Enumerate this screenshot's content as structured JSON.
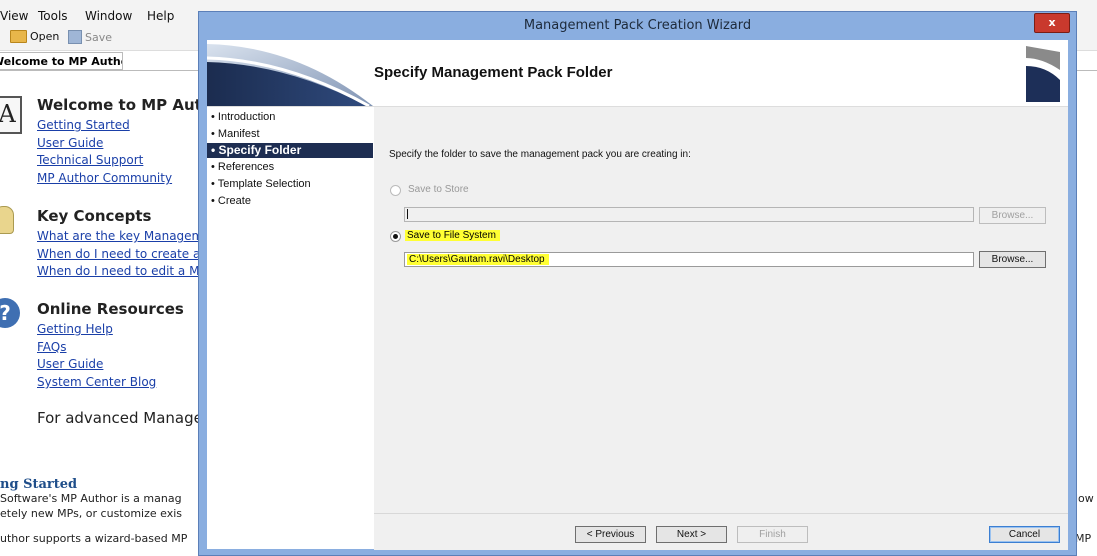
{
  "menu": [
    "View",
    "Tools",
    "Window",
    "Help"
  ],
  "toolbar": {
    "open_label": "Open",
    "save_label": "Save"
  },
  "doc_tab": {
    "label": "Welcome to MP Author!",
    "close": "×"
  },
  "welcome": {
    "heading": "Welcome to MP Author",
    "links": [
      "Getting Started",
      "User Guide",
      "Technical Support",
      "MP Author Community"
    ]
  },
  "key_concepts": {
    "heading": "Key Concepts",
    "links": [
      "What are the key Management",
      "When do I need to create a",
      "When do I need to edit a M"
    ]
  },
  "online": {
    "heading": "Online Resources",
    "links": [
      "Getting Help",
      "FAQs",
      "User Guide",
      "System Center Blog"
    ]
  },
  "advanced_text": "For advanced Manage",
  "getting_started": {
    "heading": "ng Started",
    "line1": "Software's MP Author is a manag",
    "line2": "etely new MPs, or customize exis",
    "line3": "uthor supports a wizard-based MP",
    "right1": "low",
    "right2": "MP"
  },
  "wizard": {
    "title": "Management Pack Creation Wizard",
    "close": "x",
    "heading": "Specify Management Pack Folder",
    "steps": [
      "Introduction",
      "Manifest",
      "Specify Folder",
      "References",
      "Template Selection",
      "Create"
    ],
    "active_step": "Specify Folder",
    "instruction": "Specify the folder to save the management pack you are creating in:",
    "option_store": "Save to Store",
    "store_path": "",
    "browse1": "Browse...",
    "option_fs": "Save to File System",
    "fs_path": "C:\\Users\\Gautam.ravi\\Desktop",
    "browse2": "Browse...",
    "btn_previous": "< Previous",
    "btn_next": "Next >",
    "btn_finish": "Finish",
    "btn_cancel": "Cancel",
    "highlight_color": "#ffff33",
    "active_step_color": "#1e2e52"
  }
}
